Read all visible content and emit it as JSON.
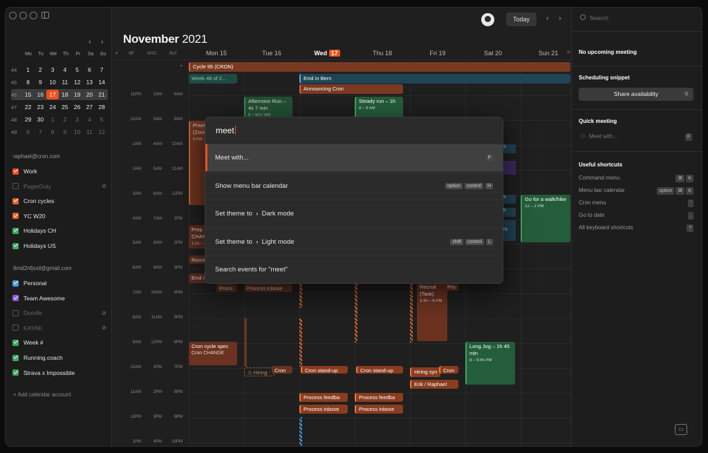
{
  "sidebar": {
    "mini_cal": {
      "weekdays": [
        "Mo",
        "Tu",
        "We",
        "Th",
        "Fr",
        "Sa",
        "Su"
      ],
      "weeks": [
        {
          "wk": "44",
          "days": [
            "1",
            "2",
            "3",
            "4",
            "5",
            "6",
            "7"
          ]
        },
        {
          "wk": "45",
          "days": [
            "8",
            "9",
            "10",
            "11",
            "12",
            "13",
            "14"
          ]
        },
        {
          "wk": "46",
          "days": [
            "15",
            "16",
            "17",
            "18",
            "19",
            "20",
            "21"
          ]
        },
        {
          "wk": "47",
          "days": [
            "22",
            "23",
            "24",
            "25",
            "26",
            "27",
            "28"
          ]
        },
        {
          "wk": "48",
          "days": [
            "29",
            "30",
            "1",
            "2",
            "3",
            "4",
            "5"
          ]
        },
        {
          "wk": "49",
          "days": [
            "6",
            "7",
            "8",
            "9",
            "10",
            "11",
            "12"
          ]
        }
      ],
      "today": "17"
    },
    "account1": "raphael@cron.com",
    "calendars1": [
      {
        "label": "Work",
        "color": "#f04f1f",
        "enabled": true
      },
      {
        "label": "PagerDuty",
        "color": "#f04f1f",
        "enabled": false
      },
      {
        "label": "Cron cycles",
        "color": "#e2652e",
        "enabled": true
      },
      {
        "label": "YC W20",
        "color": "#e2652e",
        "enabled": true
      },
      {
        "label": "Holidays CH",
        "color": "#3ea765",
        "enabled": true
      },
      {
        "label": "Holidays US",
        "color": "#3ea765",
        "enabled": true
      }
    ],
    "account2": "9md2nfjsxil@gmail.com",
    "calendars2": [
      {
        "label": "Personal",
        "color": "#4a9ddb",
        "enabled": true
      },
      {
        "label": "Team Awesome",
        "color": "#8b5ad6",
        "enabled": true
      },
      {
        "label": "Doodle",
        "color": "#555",
        "enabled": false
      },
      {
        "label": "KAYAK",
        "color": "#555",
        "enabled": false
      },
      {
        "label": "Week #",
        "color": "#3ea765",
        "enabled": true
      },
      {
        "label": "Running.coach",
        "color": "#3ea765",
        "enabled": true
      },
      {
        "label": "Strava x Impossible",
        "color": "#3ea765",
        "enabled": true
      }
    ],
    "add_account": "+ Add calendar account"
  },
  "header": {
    "month": "November",
    "year": "2021",
    "today_button": "Today",
    "timezones": [
      "SF",
      "NYC",
      "SUI"
    ],
    "days": [
      "Mon 15",
      "Tue 16",
      "Wed",
      "Thu 18",
      "Fri 19",
      "Sat 20",
      "Sun 21"
    ],
    "wed_num": "17"
  },
  "times": [
    [
      "11PM",
      "2AM",
      "8AM"
    ],
    [
      "12AM",
      "3AM",
      "9AM"
    ],
    [
      "1AM",
      "4AM",
      "10AM"
    ],
    [
      "2AM",
      "5AM",
      "11AM"
    ],
    [
      "3AM",
      "6AM",
      "12PM"
    ],
    [
      "4AM",
      "7AM",
      "1PM"
    ],
    [
      "5AM",
      "8AM",
      "2PM"
    ],
    [
      "6AM",
      "9AM",
      "3PM"
    ],
    [
      "7AM",
      "10AM",
      "4PM"
    ],
    [
      "8AM",
      "11AM",
      "5PM"
    ],
    [
      "9AM",
      "12PM",
      "6PM"
    ],
    [
      "10AM",
      "1PM",
      "7PM"
    ],
    [
      "11AM",
      "2PM",
      "8PM"
    ],
    [
      "12PM",
      "3PM",
      "9PM"
    ],
    [
      "1PM",
      "4PM",
      "10PM"
    ]
  ],
  "events": {
    "cycle": "Cycle 95 (CRON)",
    "week46": "Week 46 of 2...",
    "emil_bern": "Emil in Bern",
    "announcing": "Announcing Cron",
    "afternoon_run": "Afternoon Run – 4x 7 min",
    "afternoon_run_time": "8 – 9:07 AM",
    "steady_run": "Steady run – 1h",
    "steady_run_time": "8 – 9 AM",
    "priority": "Priorit (Zone",
    "priority_time": "9 AM –",
    "go_for_walk": "Go for a walk/hike",
    "go_for_walk_time": "12 – 2 PM",
    "prep": "Prep CHANC",
    "prep_time": "1:15 – 2",
    "roma": "Roma",
    "emil": "Emil /",
    "proc1": "Proce",
    "process_inbox": "Process inboxe",
    "recruit": "Recruit (Task)",
    "recruit_time": "3:30 – 6 PM",
    "pro": "Pro",
    "cron_cycle_spec": "Cron cycle spec",
    "cron_change": "Cron CHANGE",
    "hiring": "⚠ Hiring :",
    "cron1": "Cron",
    "cron_standup": "Cron stand-up",
    "cron_standup2": "Cron stand-up",
    "hiring_syn": "Hiring syn",
    "cron2": "Cron",
    "long_jog": "Long Jog – 1h 45 min",
    "long_jog_time": "8 – 9:45 PM",
    "erik": "Erik / Raphael",
    "process_feedba": "Process feedba",
    "process_feedba2": "Process feedba",
    "process_inboxe": "Process inboxe",
    "process_inboxe2": "Process inboxe"
  },
  "right_panel": {
    "search_placeholder": "Search",
    "no_meeting": "No upcoming meeting",
    "scheduling": "Scheduling snippet",
    "share": "Share availability",
    "share_key": "S",
    "quick_meeting": "Quick meeting",
    "meet_with_placeholder": "Meet with...",
    "meet_key": "F",
    "shortcuts_title": "Useful shortcuts",
    "shortcuts": [
      {
        "label": "Command menu",
        "keys": [
          "⌘",
          "K"
        ]
      },
      {
        "label": "Menu bar calendar",
        "keys": [
          "option",
          "⌘",
          "K"
        ]
      },
      {
        "label": "Cron menu",
        "keys": [
          "`"
        ]
      },
      {
        "label": "Go to date",
        "keys": [
          "."
        ]
      },
      {
        "label": "All keyboard shortcuts",
        "keys": [
          "?"
        ]
      }
    ]
  },
  "command_menu": {
    "query": "meet",
    "items": [
      {
        "label": "Meet with...",
        "keys": [
          "F"
        ]
      },
      {
        "label": "Show menu bar calendar",
        "keys": [
          "option",
          "control",
          "H"
        ]
      },
      {
        "label": "Set theme to  ›  Dark mode",
        "keys": []
      },
      {
        "label": "Set theme to  ›  Light mode",
        "keys": [
          "shift",
          "control",
          "L"
        ]
      },
      {
        "label": "Search events for \"meet\"",
        "keys": []
      }
    ]
  }
}
